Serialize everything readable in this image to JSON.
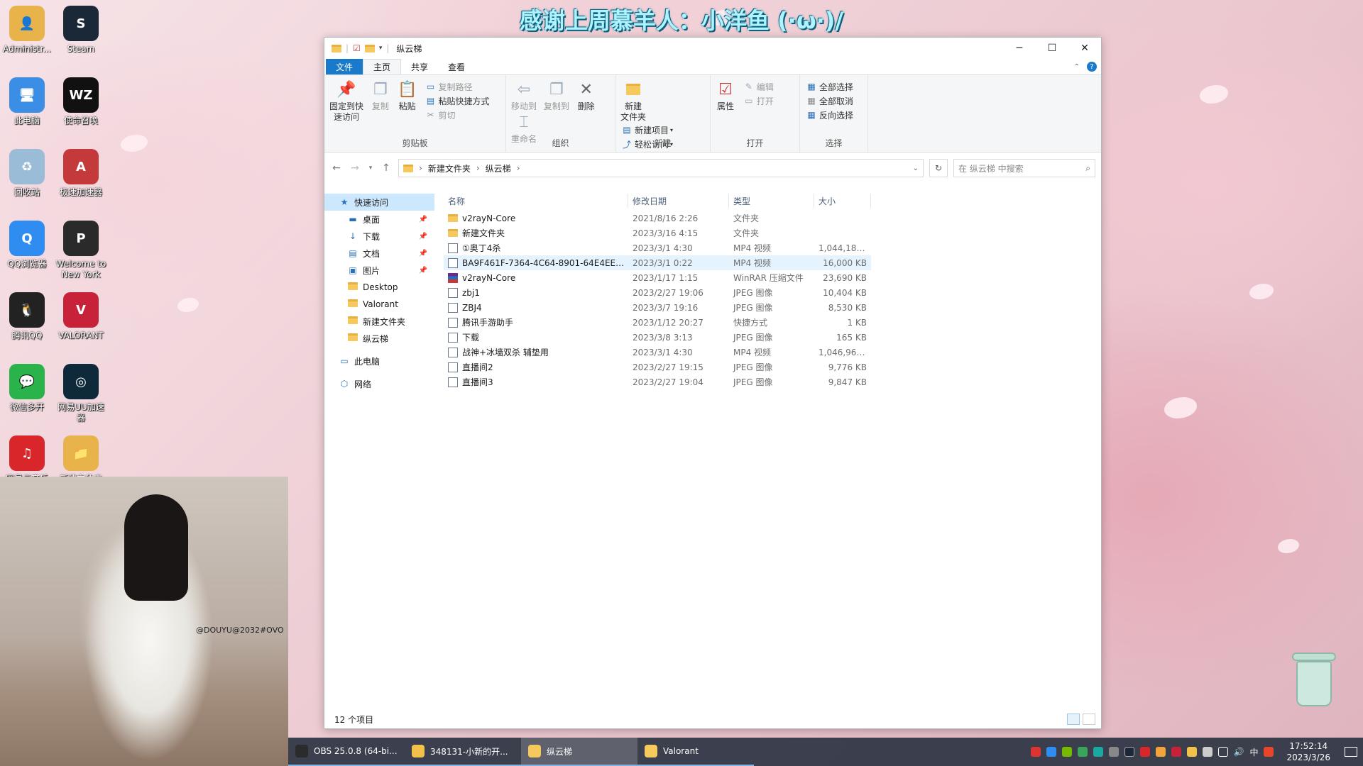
{
  "banner": "感谢上周慕羊人：小洋鱼 (·ω·)/",
  "desktop_icons": [
    {
      "label": "Administr...",
      "color": "#e7b34a",
      "glyph": "👤"
    },
    {
      "label": "Steam",
      "color": "#1b2838",
      "glyph": "S"
    },
    {
      "label": "此电脑",
      "color": "#3a8ee6",
      "glyph": "🖥"
    },
    {
      "label": "使命召唤",
      "color": "#111111",
      "glyph": "WZ"
    },
    {
      "label": "回收站",
      "color": "#9bbcd6",
      "glyph": "♻"
    },
    {
      "label": "极速加速器",
      "color": "#c43a3a",
      "glyph": "A"
    },
    {
      "label": "QQ浏览器",
      "color": "#2f8df2",
      "glyph": "Q"
    },
    {
      "label": "Welcome to New York",
      "color": "#2a2a2a",
      "glyph": "P"
    },
    {
      "label": "腾讯QQ",
      "color": "#222222",
      "glyph": "🐧"
    },
    {
      "label": "VALORANT",
      "color": "#c8213a",
      "glyph": "V"
    },
    {
      "label": "微信多开",
      "color": "#29b34a",
      "glyph": "💬"
    },
    {
      "label": "网易UU加速器",
      "color": "#0e2a3a",
      "glyph": "◎"
    },
    {
      "label": "网易云音乐",
      "color": "#d9262b",
      "glyph": "♫"
    },
    {
      "label": "新建文件夹",
      "color": "#e7b34a",
      "glyph": "📁"
    }
  ],
  "webcam": {
    "watermark": "@DOUYU@2032#OVO"
  },
  "window": {
    "title": "纵云梯",
    "tabs": {
      "file": "文件",
      "home": "主页",
      "share": "共享",
      "view": "查看"
    },
    "ribbon": {
      "clipboard": {
        "name": "剪贴板",
        "pin": "固定到快\n速访问",
        "copy": "复制",
        "paste": "粘贴",
        "copy_path": "复制路径",
        "paste_shortcut": "粘贴快捷方式",
        "cut": "剪切"
      },
      "organize": {
        "name": "组织",
        "move_to": "移动到",
        "copy_to": "复制到",
        "delete": "删除",
        "rename": "重命名"
      },
      "new": {
        "name": "新建",
        "new_folder": "新建\n文件夹",
        "new_item": "新建项目",
        "easy_access": "轻松访问"
      },
      "open": {
        "name": "打开",
        "properties": "属性",
        "open": "打开",
        "edit": "编辑"
      },
      "select": {
        "name": "选择",
        "select_all": "全部选择",
        "select_none": "全部取消",
        "invert": "反向选择"
      }
    },
    "address": {
      "crumbs": [
        "新建文件夹",
        "纵云梯"
      ],
      "search_placeholder": "在 纵云梯 中搜索"
    },
    "sidebar": [
      {
        "label": "快速访问",
        "icon": "★",
        "level": 0,
        "selected": true,
        "pin": false
      },
      {
        "label": "桌面",
        "icon": "▬",
        "level": 1,
        "selected": false,
        "pin": true
      },
      {
        "label": "下载",
        "icon": "↓",
        "level": 1,
        "selected": false,
        "pin": true
      },
      {
        "label": "文档",
        "icon": "▤",
        "level": 1,
        "selected": false,
        "pin": true
      },
      {
        "label": "图片",
        "icon": "▣",
        "level": 1,
        "selected": false,
        "pin": true
      },
      {
        "label": "Desktop",
        "icon": "folder",
        "level": 1,
        "selected": false,
        "pin": false
      },
      {
        "label": "Valorant",
        "icon": "folder",
        "level": 1,
        "selected": false,
        "pin": false
      },
      {
        "label": "新建文件夹",
        "icon": "folder",
        "level": 1,
        "selected": false,
        "pin": false
      },
      {
        "label": "纵云梯",
        "icon": "folder",
        "level": 1,
        "selected": false,
        "pin": false
      },
      {
        "label": "此电脑",
        "icon": "▭",
        "level": 0,
        "selected": false,
        "pin": false,
        "gap": true
      },
      {
        "label": "网络",
        "icon": "⬡",
        "level": 0,
        "selected": false,
        "pin": false,
        "gap": true
      }
    ],
    "columns": {
      "name": "名称",
      "date": "修改日期",
      "type": "类型",
      "size": "大小"
    },
    "files": [
      {
        "name": "v2rayN-Core",
        "date": "2021/8/16 2:26",
        "type": "文件夹",
        "size": "",
        "icon": "folder"
      },
      {
        "name": "新建文件夹",
        "date": "2023/3/16 4:15",
        "type": "文件夹",
        "size": "",
        "icon": "folder"
      },
      {
        "name": "①奥丁4杀",
        "date": "2023/3/1 4:30",
        "type": "MP4 视频",
        "size": "1,044,189...",
        "icon": "file"
      },
      {
        "name": "BA9F461F-7364-4C64-8901-64E4EEC...",
        "date": "2023/3/1 0:22",
        "type": "MP4 视频",
        "size": "16,000 KB",
        "icon": "file",
        "hl": true
      },
      {
        "name": "v2rayN-Core",
        "date": "2023/1/17 1:15",
        "type": "WinRAR 压缩文件",
        "size": "23,690 KB",
        "icon": "rar"
      },
      {
        "name": "zbj1",
        "date": "2023/2/27 19:06",
        "type": "JPEG 图像",
        "size": "10,404 KB",
        "icon": "file"
      },
      {
        "name": "ZBJ4",
        "date": "2023/3/7 19:16",
        "type": "JPEG 图像",
        "size": "8,530 KB",
        "icon": "file"
      },
      {
        "name": "腾讯手游助手",
        "date": "2023/1/12 20:27",
        "type": "快捷方式",
        "size": "1 KB",
        "icon": "file"
      },
      {
        "name": "下载",
        "date": "2023/3/8 3:13",
        "type": "JPEG 图像",
        "size": "165 KB",
        "icon": "file"
      },
      {
        "name": "战神+冰墙双杀 辅垫用",
        "date": "2023/3/1 4:30",
        "type": "MP4 视频",
        "size": "1,046,964...",
        "icon": "file"
      },
      {
        "name": "直播间2",
        "date": "2023/2/27 19:15",
        "type": "JPEG 图像",
        "size": "9,776 KB",
        "icon": "file"
      },
      {
        "name": "直播间3",
        "date": "2023/2/27 19:04",
        "type": "JPEG 图像",
        "size": "9,847 KB",
        "icon": "file"
      }
    ],
    "status": "12 个项目"
  },
  "taskbar": {
    "apps": [
      {
        "label": "OBS 25.0.8 (64-bi...",
        "color": "#2b2b2b",
        "active": false
      },
      {
        "label": "348131-小新的开...",
        "color": "#f2c14a",
        "active": false
      },
      {
        "label": "纵云梯",
        "color": "#f6c95f",
        "active": true
      },
      {
        "label": "Valorant",
        "color": "#f6c95f",
        "active": false
      }
    ],
    "ime": "中",
    "time": "17:52:14",
    "date": "2023/3/26"
  }
}
